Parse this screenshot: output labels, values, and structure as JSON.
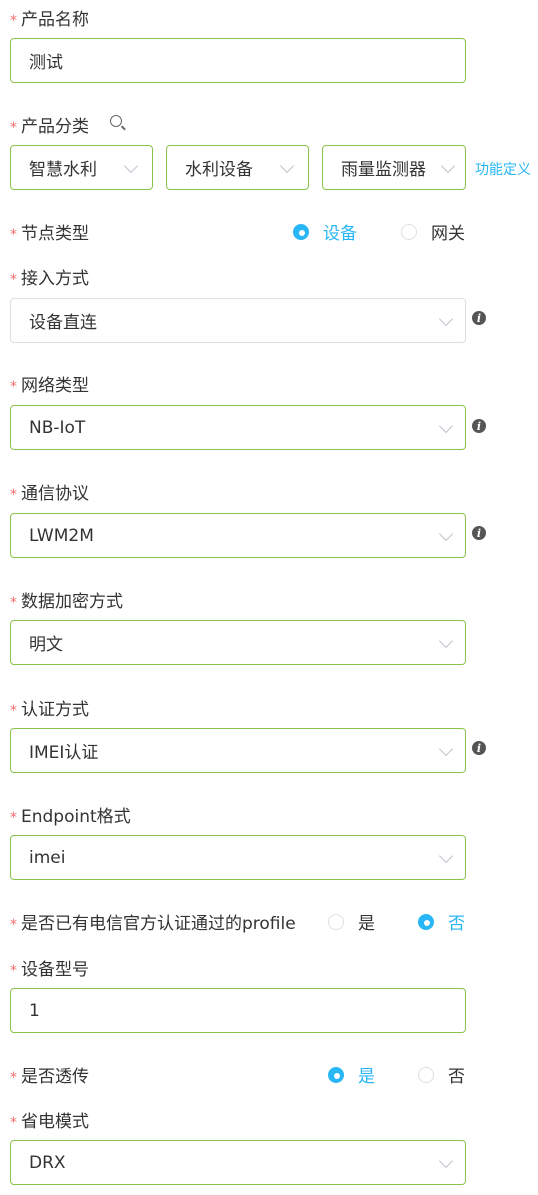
{
  "form": {
    "product_name": {
      "label": "产品名称",
      "value": "测试"
    },
    "product_category": {
      "label": "产品分类",
      "level1": "智慧水利",
      "level2": "水利设备",
      "level3": "雨量监测器",
      "link": "功能定义"
    },
    "node_type": {
      "label": "节点类型",
      "options": [
        "设备",
        "网关"
      ],
      "selected": "设备"
    },
    "access_method": {
      "label": "接入方式",
      "value": "设备直连"
    },
    "network_type": {
      "label": "网络类型",
      "value": "NB-IoT"
    },
    "protocol": {
      "label": "通信协议",
      "value": "LWM2M"
    },
    "encryption": {
      "label": "数据加密方式",
      "value": "明文"
    },
    "auth_method": {
      "label": "认证方式",
      "value": "IMEI认证"
    },
    "endpoint_format": {
      "label": "Endpoint格式",
      "value": "imei"
    },
    "telecom_profile": {
      "label": "是否已有电信官方认证通过的profile",
      "options": [
        "是",
        "否"
      ],
      "selected": "否"
    },
    "device_model": {
      "label": "设备型号",
      "value": "1"
    },
    "passthrough": {
      "label": "是否透传",
      "options": [
        "是",
        "否"
      ],
      "selected": "是"
    },
    "power_mode": {
      "label": "省电模式",
      "value": "DRX"
    }
  },
  "colors": {
    "accent": "#29b6f6",
    "valid_border": "#8bc34a",
    "required_star": "#f56c6c"
  }
}
